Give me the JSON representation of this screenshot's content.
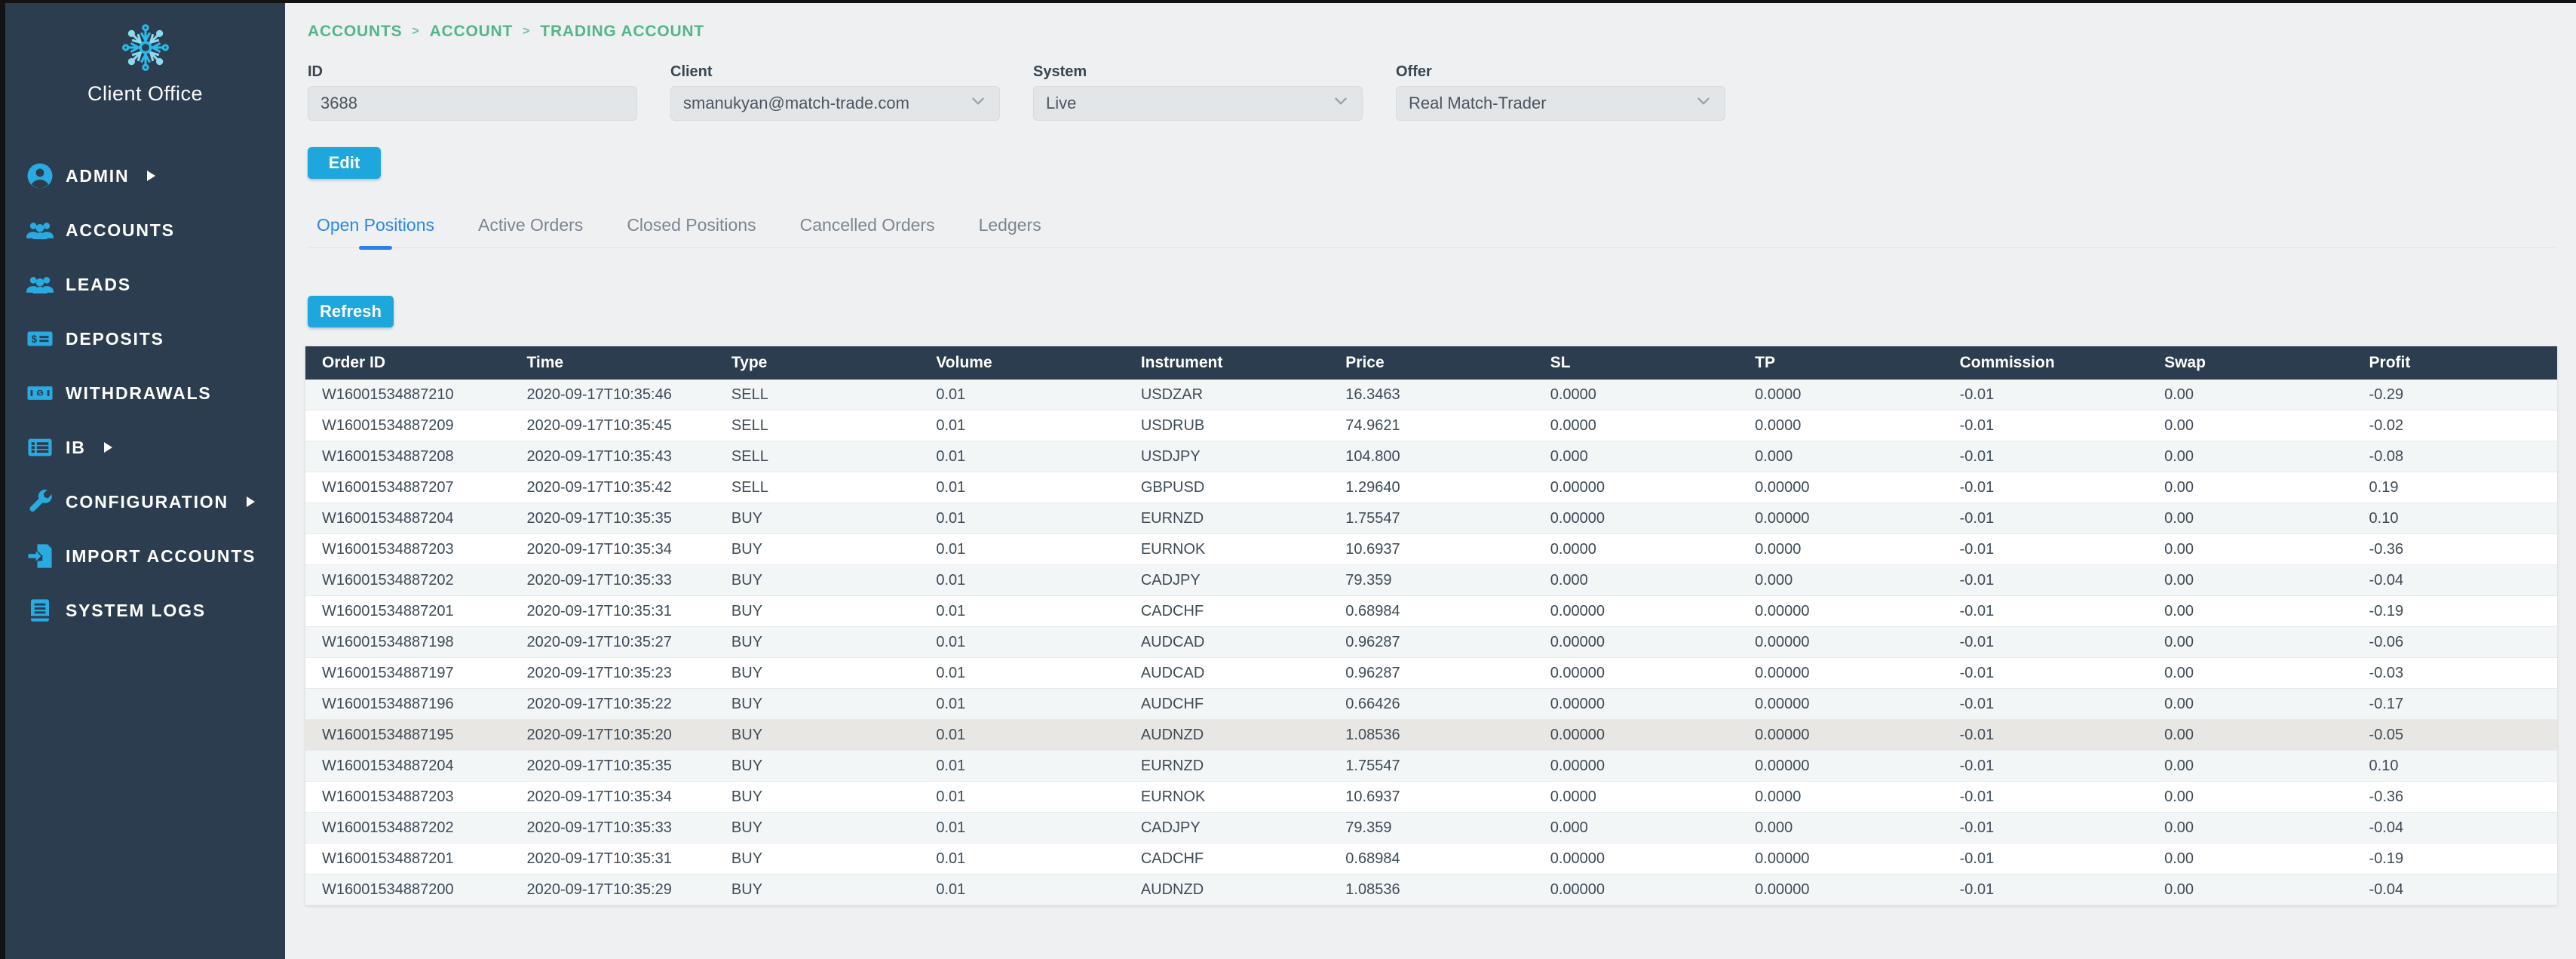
{
  "colors": {
    "sidebar_bg": "#2c3d4f",
    "accent_cyan": "#29abe2",
    "breadcrumb_green": "#53b688",
    "button_blue": "#1ea7dd",
    "tab_active_blue": "#2b87e8",
    "table_header_bg": "#2c3d4f",
    "row_stripe": "#f3f6f7",
    "row_highlight": "#e9e7e3",
    "page_bg": "#eef0f1"
  },
  "sidebar": {
    "logo_label": "Client Office",
    "items": [
      {
        "label": "ADMIN",
        "icon": "user-circle-icon",
        "has_submenu": true
      },
      {
        "label": "ACCOUNTS",
        "icon": "users-icon",
        "has_submenu": false
      },
      {
        "label": "LEADS",
        "icon": "users-icon",
        "has_submenu": false
      },
      {
        "label": "DEPOSITS",
        "icon": "money-check-icon",
        "has_submenu": false
      },
      {
        "label": "WITHDRAWALS",
        "icon": "money-bill-icon",
        "has_submenu": false
      },
      {
        "label": "IB",
        "icon": "list-icon",
        "has_submenu": true
      },
      {
        "label": "CONFIGURATION",
        "icon": "wrench-icon",
        "has_submenu": true
      },
      {
        "label": "IMPORT ACCOUNTS",
        "icon": "file-import-icon",
        "has_submenu": false
      },
      {
        "label": "SYSTEM LOGS",
        "icon": "book-icon",
        "has_submenu": false
      }
    ]
  },
  "breadcrumb": {
    "separator": ">",
    "items": [
      "ACCOUNTS",
      "ACCOUNT",
      "TRADING ACCOUNT"
    ]
  },
  "form": {
    "fields": [
      {
        "label": "ID",
        "value": "3688",
        "type": "text"
      },
      {
        "label": "Client",
        "value": "smanukyan@match-trade.com",
        "type": "select"
      },
      {
        "label": "System",
        "value": "Live",
        "type": "select"
      },
      {
        "label": "Offer",
        "value": "Real Match-Trader",
        "type": "select"
      }
    ]
  },
  "actions": {
    "edit_label": "Edit",
    "refresh_label": "Refresh"
  },
  "tabs": {
    "active": "Open Positions",
    "items": [
      "Open Positions",
      "Active Orders",
      "Closed Positions",
      "Cancelled Orders",
      "Ledgers"
    ]
  },
  "table": {
    "columns": [
      "Order ID",
      "Time",
      "Type",
      "Volume",
      "Instrument",
      "Price",
      "SL",
      "TP",
      "Commission",
      "Swap",
      "Profit"
    ],
    "highlighted_row_index": 11,
    "rows": [
      [
        "W16001534887210",
        "2020-09-17T10:35:46",
        "SELL",
        "0.01",
        "USDZAR",
        "16.3463",
        "0.0000",
        "0.0000",
        "-0.01",
        "0.00",
        "-0.29"
      ],
      [
        "W16001534887209",
        "2020-09-17T10:35:45",
        "SELL",
        "0.01",
        "USDRUB",
        "74.9621",
        "0.0000",
        "0.0000",
        "-0.01",
        "0.00",
        "-0.02"
      ],
      [
        "W16001534887208",
        "2020-09-17T10:35:43",
        "SELL",
        "0.01",
        "USDJPY",
        "104.800",
        "0.000",
        "0.000",
        "-0.01",
        "0.00",
        "-0.08"
      ],
      [
        "W16001534887207",
        "2020-09-17T10:35:42",
        "SELL",
        "0.01",
        "GBPUSD",
        "1.29640",
        "0.00000",
        "0.00000",
        "-0.01",
        "0.00",
        "0.19"
      ],
      [
        "W16001534887204",
        "2020-09-17T10:35:35",
        "BUY",
        "0.01",
        "EURNZD",
        "1.75547",
        "0.00000",
        "0.00000",
        "-0.01",
        "0.00",
        "0.10"
      ],
      [
        "W16001534887203",
        "2020-09-17T10:35:34",
        "BUY",
        "0.01",
        "EURNOK",
        "10.6937",
        "0.0000",
        "0.0000",
        "-0.01",
        "0.00",
        "-0.36"
      ],
      [
        "W16001534887202",
        "2020-09-17T10:35:33",
        "BUY",
        "0.01",
        "CADJPY",
        "79.359",
        "0.000",
        "0.000",
        "-0.01",
        "0.00",
        "-0.04"
      ],
      [
        "W16001534887201",
        "2020-09-17T10:35:31",
        "BUY",
        "0.01",
        "CADCHF",
        "0.68984",
        "0.00000",
        "0.00000",
        "-0.01",
        "0.00",
        "-0.19"
      ],
      [
        "W16001534887198",
        "2020-09-17T10:35:27",
        "BUY",
        "0.01",
        "AUDCAD",
        "0.96287",
        "0.00000",
        "0.00000",
        "-0.01",
        "0.00",
        "-0.06"
      ],
      [
        "W16001534887197",
        "2020-09-17T10:35:23",
        "BUY",
        "0.01",
        "AUDCAD",
        "0.96287",
        "0.00000",
        "0.00000",
        "-0.01",
        "0.00",
        "-0.03"
      ],
      [
        "W16001534887196",
        "2020-09-17T10:35:22",
        "BUY",
        "0.01",
        "AUDCHF",
        "0.66426",
        "0.00000",
        "0.00000",
        "-0.01",
        "0.00",
        "-0.17"
      ],
      [
        "W16001534887195",
        "2020-09-17T10:35:20",
        "BUY",
        "0.01",
        "AUDNZD",
        "1.08536",
        "0.00000",
        "0.00000",
        "-0.01",
        "0.00",
        "-0.05"
      ],
      [
        "W16001534887204",
        "2020-09-17T10:35:35",
        "BUY",
        "0.01",
        "EURNZD",
        "1.75547",
        "0.00000",
        "0.00000",
        "-0.01",
        "0.00",
        "0.10"
      ],
      [
        "W16001534887203",
        "2020-09-17T10:35:34",
        "BUY",
        "0.01",
        "EURNOK",
        "10.6937",
        "0.0000",
        "0.0000",
        "-0.01",
        "0.00",
        "-0.36"
      ],
      [
        "W16001534887202",
        "2020-09-17T10:35:33",
        "BUY",
        "0.01",
        "CADJPY",
        "79.359",
        "0.000",
        "0.000",
        "-0.01",
        "0.00",
        "-0.04"
      ],
      [
        "W16001534887201",
        "2020-09-17T10:35:31",
        "BUY",
        "0.01",
        "CADCHF",
        "0.68984",
        "0.00000",
        "0.00000",
        "-0.01",
        "0.00",
        "-0.19"
      ],
      [
        "W16001534887200",
        "2020-09-17T10:35:29",
        "BUY",
        "0.01",
        "AUDNZD",
        "1.08536",
        "0.00000",
        "0.00000",
        "-0.01",
        "0.00",
        "-0.04"
      ]
    ]
  }
}
